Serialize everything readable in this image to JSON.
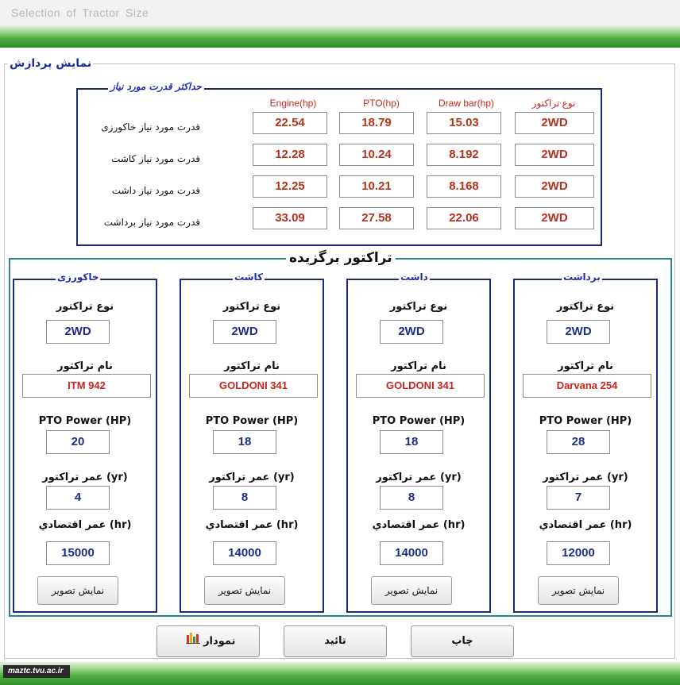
{
  "window": {
    "title": "Selection  of  Tractor Size"
  },
  "process_group": {
    "label": "نمایش پردازش"
  },
  "required_power": {
    "label": "حداکثر قدرت مورد نیاز",
    "headers": {
      "tractor_type": "نوع تراکتور",
      "drawbar": "Draw bar(hp)",
      "pto": "PTO(hp)",
      "engine": "Engine(hp)"
    },
    "rows": [
      {
        "label": "قدرت مورد نیاز خاکورزی",
        "type": "2WD",
        "drawbar": "15.03",
        "pto": "18.79",
        "engine": "22.54"
      },
      {
        "label": "قدرت مورد نیاز کاشت",
        "type": "2WD",
        "drawbar": "8.192",
        "pto": "10.24",
        "engine": "12.28"
      },
      {
        "label": "قدرت مورد نیاز داشت",
        "type": "2WD",
        "drawbar": "8.168",
        "pto": "10.21",
        "engine": "12.25"
      },
      {
        "label": "قدرت مورد نیاز برداشت",
        "type": "2WD",
        "drawbar": "22.06",
        "pto": "27.58",
        "engine": "33.09"
      }
    ]
  },
  "selected_tractor": {
    "label": "تراکتور برگزیده",
    "field_labels": {
      "type": "نوع تراکتور",
      "name": "نام تراکتور",
      "pto_power": "PTO Power (HP)",
      "age": "عمر تراکتور (yr)",
      "economic_life": "عمر اقتصادي (hr)",
      "show_image": "نمایش تصویر"
    },
    "cards": [
      {
        "title": "خاکورزی",
        "type": "2WD",
        "name": "ITM 942",
        "pto_power": "20",
        "age": "4",
        "economic_life": "15000"
      },
      {
        "title": "کاشت",
        "type": "2WD",
        "name": "GOLDONI 341",
        "pto_power": "18",
        "age": "8",
        "economic_life": "14000"
      },
      {
        "title": "داشت",
        "type": "2WD",
        "name": "GOLDONI 341",
        "pto_power": "18",
        "age": "8",
        "economic_life": "14000"
      },
      {
        "title": "برداشت",
        "type": "2WD",
        "name": "Darvana 254",
        "pto_power": "28",
        "age": "7",
        "economic_life": "12000"
      }
    ]
  },
  "buttons": {
    "chart": "نمودار",
    "confirm": "تائید",
    "print": "چاپ"
  },
  "watermark": "maztc.tvu.ac.ir",
  "colors": {
    "accent_blue": "#1b2fb0",
    "header_red": "#c8261e",
    "value_red": "#b5321c",
    "teal_border": "#2a8a8a",
    "green_bar": "#2f8f28"
  }
}
